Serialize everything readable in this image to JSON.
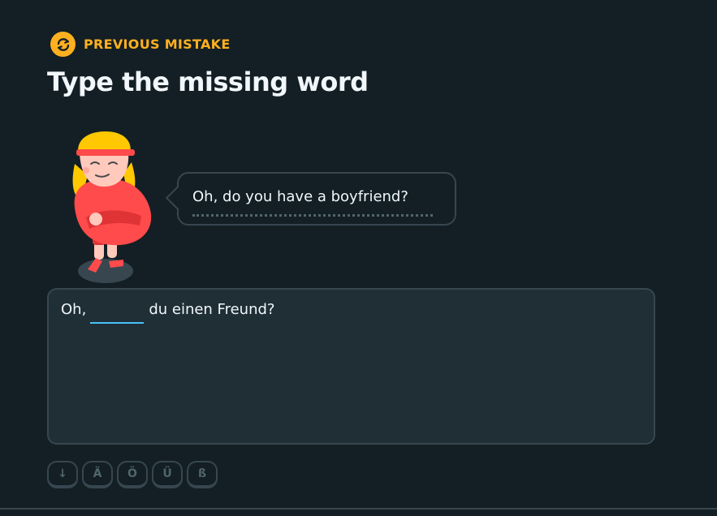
{
  "badge": {
    "label": "PREVIOUS MISTAKE",
    "icon": "refresh-icon"
  },
  "title": "Type the missing word",
  "character": {
    "icon": "character-illustration"
  },
  "bubble": {
    "text": "Oh, do you have a boyfriend?"
  },
  "sentence": {
    "before": "Oh,",
    "answer": "",
    "after": "du einen Freund?"
  },
  "keyboard": {
    "keys": [
      {
        "label": "↓",
        "icon": "collapse-arrow-icon"
      },
      {
        "label": "Ä"
      },
      {
        "label": "Ö"
      },
      {
        "label": "Ü"
      },
      {
        "label": "ß"
      }
    ]
  },
  "colors": {
    "background": "#131f24",
    "accent": "#ffb020",
    "panel": "#202f36",
    "border": "#37464f",
    "input_underline": "#49c0f8",
    "text": "#f1f7fb"
  }
}
